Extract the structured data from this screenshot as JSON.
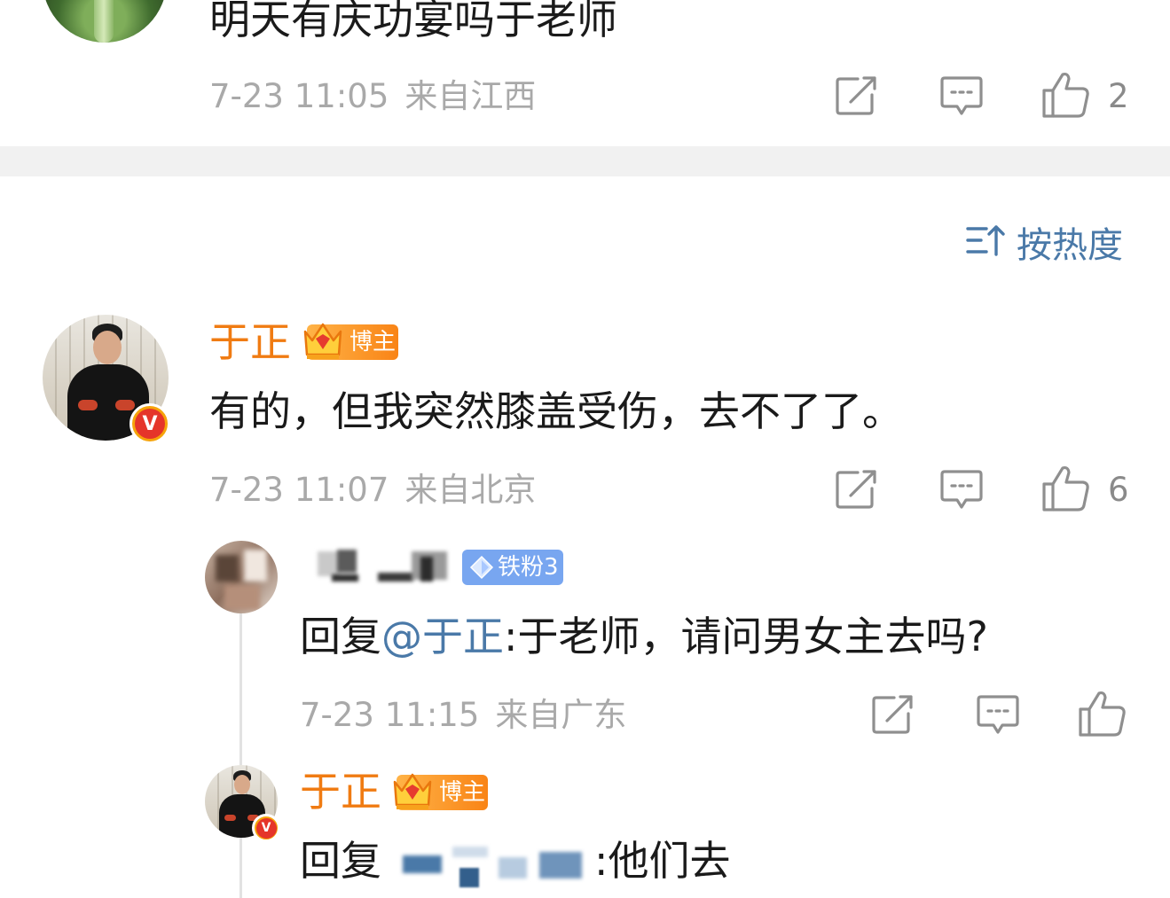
{
  "top_comment": {
    "text": "明天有庆功宴吗于老师",
    "time": "7-23 11:05",
    "location": "来自江西",
    "like_count": "2",
    "icons": [
      "share-icon",
      "comment-icon",
      "like-icon"
    ]
  },
  "sort": {
    "label": "按热度",
    "icon": "sort-icon"
  },
  "main_comment": {
    "username": "于正",
    "badge": "博主",
    "verified": "V",
    "text": "有的，但我突然膝盖受伤，去不了了。",
    "time": "7-23 11:07",
    "location": "来自北京",
    "like_count": "6"
  },
  "reply_1": {
    "badge": "铁粉3",
    "reply_prefix": "回复",
    "mention": "@于正",
    "text": ":于老师，请问男女主去吗?",
    "time": "7-23 11:15",
    "location": "来自广东"
  },
  "reply_2": {
    "username": "于正",
    "badge": "博主",
    "reply_prefix": "回复",
    "text": ":他们去"
  },
  "colors": {
    "accent_orange": "#f07b12",
    "link_blue": "#4a79a8",
    "meta_gray": "#a9a9a9",
    "badge_blue": "#78a6f0",
    "divider": "#f1f1f1"
  }
}
